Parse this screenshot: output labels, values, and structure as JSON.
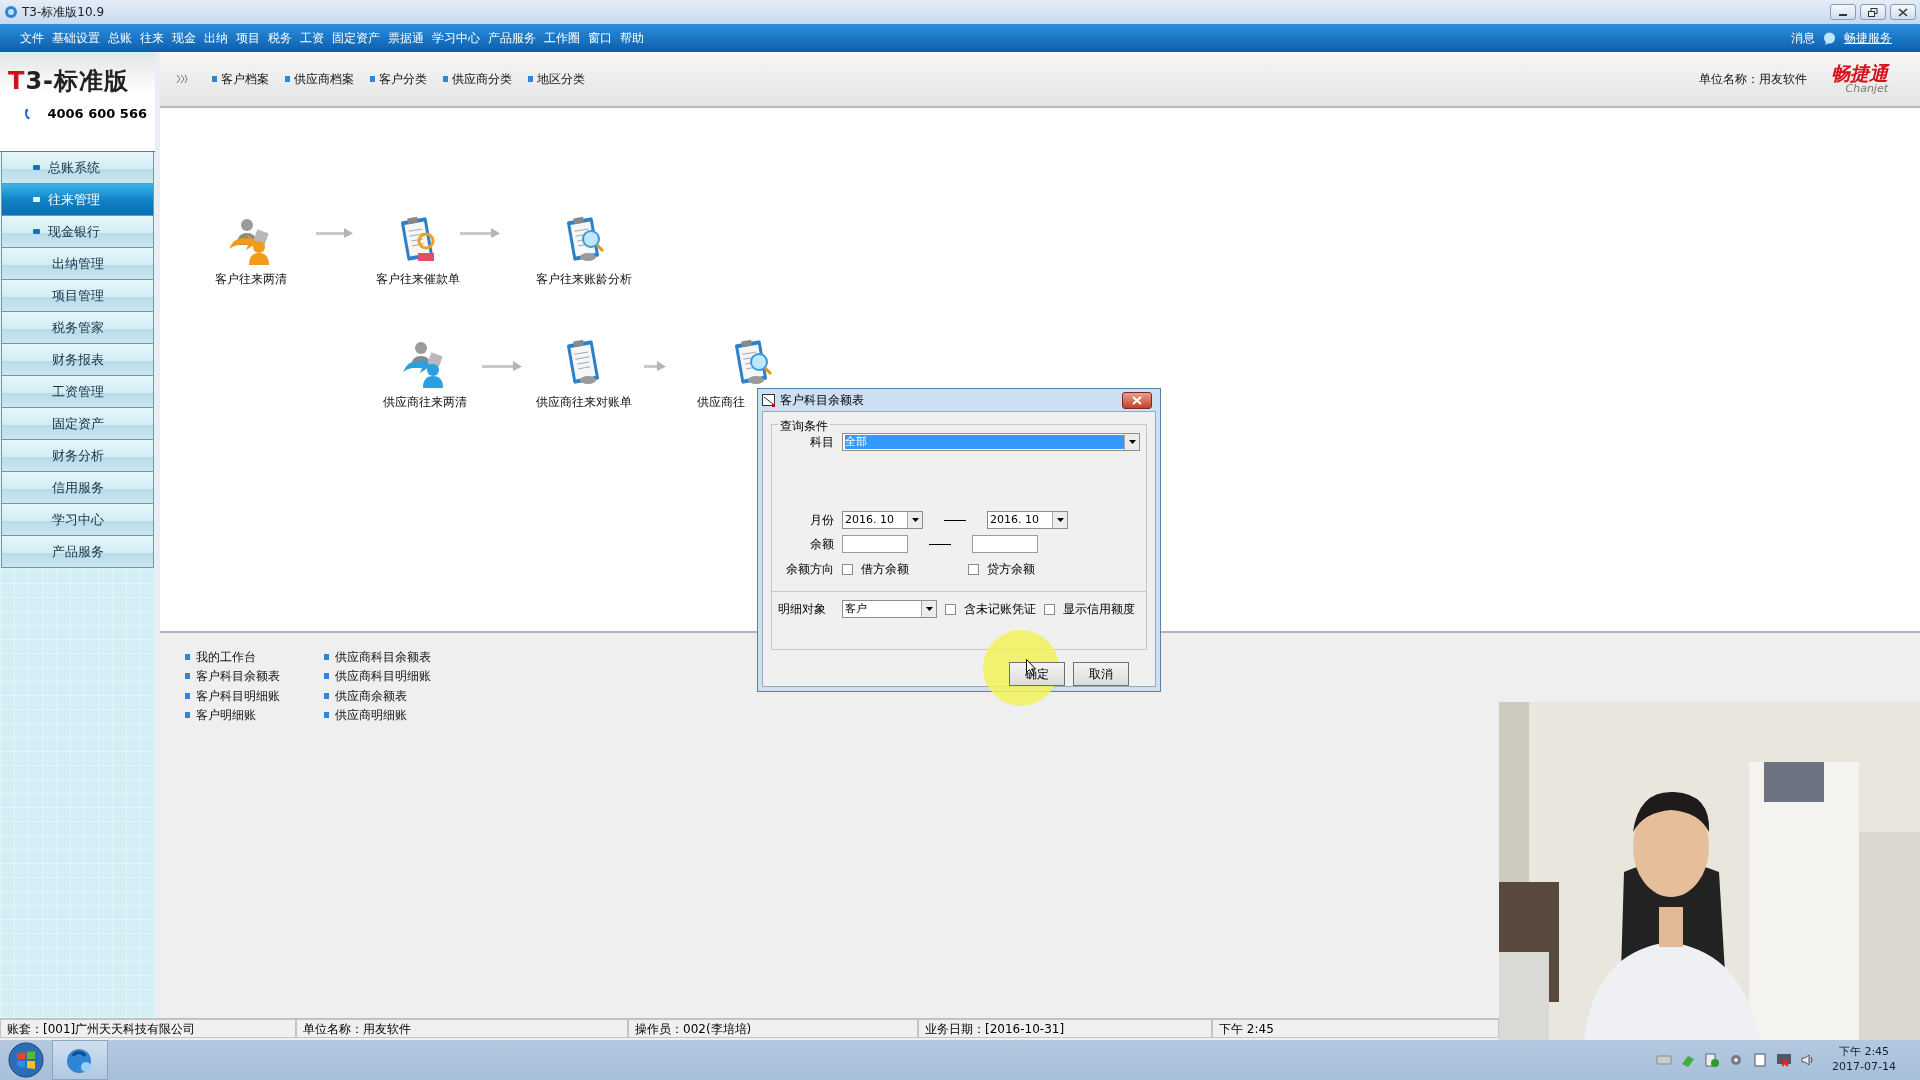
{
  "window": {
    "title": "T3-标准版10.9"
  },
  "menu": [
    "文件",
    "基础设置",
    "总账",
    "往来",
    "现金",
    "出纳",
    "项目",
    "税务",
    "工资",
    "固定资产",
    "票据通",
    "学习中心",
    "产品服务",
    "工作圈",
    "窗口",
    "帮助"
  ],
  "menu_right": {
    "messages": "消息",
    "service": "畅捷服务"
  },
  "logo": {
    "title": "T3-标准版",
    "phone": "4006 600 566"
  },
  "toolbar": [
    "客户档案",
    "供应商档案",
    "客户分类",
    "供应商分类",
    "地区分类"
  ],
  "unit_name": "单位名称：用友软件",
  "brand": {
    "name": "畅捷通",
    "sub": "Chanjet"
  },
  "sidebar": [
    {
      "label": "总账系统",
      "selected": false,
      "bullet": true
    },
    {
      "label": "往来管理",
      "selected": true,
      "bullet": true
    },
    {
      "label": "现金银行",
      "selected": false,
      "bullet": true
    },
    {
      "label": "出纳管理",
      "selected": false,
      "bullet": false
    },
    {
      "label": "项目管理",
      "selected": false,
      "bullet": false
    },
    {
      "label": "税务管家",
      "selected": false,
      "bullet": false
    },
    {
      "label": "财务报表",
      "selected": false,
      "bullet": false
    },
    {
      "label": "工资管理",
      "selected": false,
      "bullet": false
    },
    {
      "label": "固定资产",
      "selected": false,
      "bullet": false
    },
    {
      "label": "财务分析",
      "selected": false,
      "bullet": false
    },
    {
      "label": "信用服务",
      "selected": false,
      "bullet": false
    },
    {
      "label": "学习中心",
      "selected": false,
      "bullet": false
    },
    {
      "label": "产品服务",
      "selected": false,
      "bullet": false
    }
  ],
  "flow": [
    {
      "label": "客户往来两清",
      "kind": "parties",
      "color": "#f29a1a"
    },
    {
      "label": "客户往来催款单",
      "kind": "reminder"
    },
    {
      "label": "客户往来账龄分析",
      "kind": "analysis"
    },
    {
      "label": "供应商往来两清",
      "kind": "parties",
      "color": "#2aa0e0"
    },
    {
      "label": "供应商往来对账单",
      "kind": "statement"
    },
    {
      "label": "供应商往",
      "kind": "analysis"
    }
  ],
  "links": [
    [
      "我的工作台",
      "客户科目余额表",
      "客户科目明细账",
      "客户明细账"
    ],
    [
      "供应商科目余额表",
      "供应商科目明细账",
      "供应商余额表",
      "供应商明细账"
    ]
  ],
  "dialog": {
    "title": "客户科目余额表",
    "group_title": "查询条件",
    "subject": {
      "label": "科目",
      "value": "全部"
    },
    "month": {
      "label": "月份",
      "from": "2016. 10",
      "to": "2016. 10"
    },
    "balance": {
      "label": "余额"
    },
    "direction": {
      "label": "余额方向",
      "options": [
        {
          "label": "借方余额",
          "checked": false
        },
        {
          "label": "贷方余额",
          "checked": false
        }
      ]
    },
    "detail": {
      "label": "明细对象",
      "value": "客户",
      "options": [
        {
          "label": "含未记账凭证",
          "checked": false
        },
        {
          "label": "显示信用额度",
          "checked": false
        }
      ]
    },
    "buttons": [
      "确定",
      "取消"
    ]
  },
  "status_bar": [
    "账套：[001]广州天天科技有限公司",
    "单位名称：用友软件",
    "操作员：002(李培培)",
    "业务日期：[2016-10-31]",
    "下午 2:45"
  ],
  "taskbar": {
    "time": "下午 2:45",
    "date": "2017-07-14"
  },
  "video": {
    "kind": "picture"
  }
}
